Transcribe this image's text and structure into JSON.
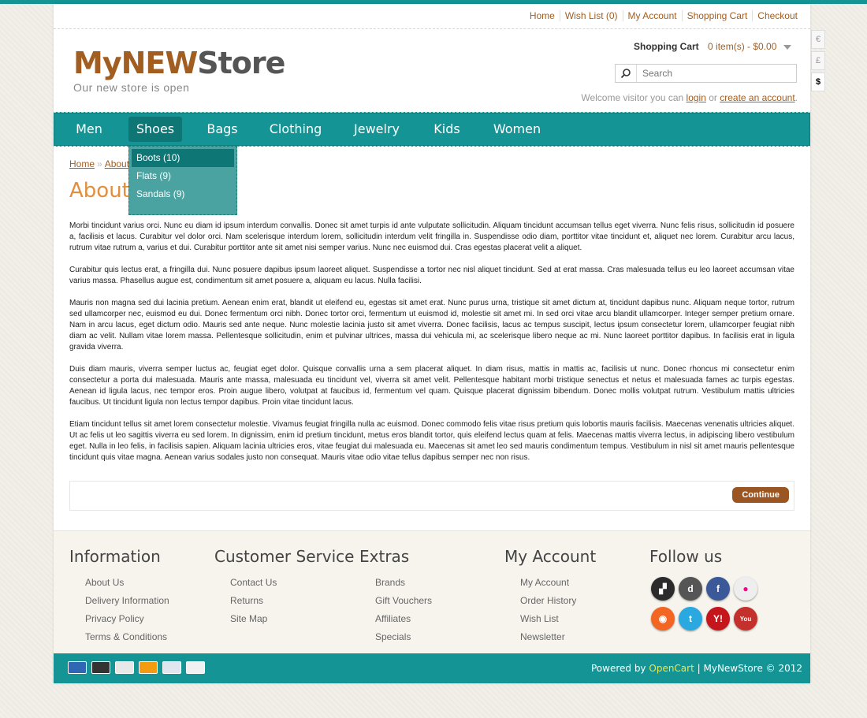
{
  "toplinks": [
    "Home",
    "Wish List (0)",
    "My Account",
    "Shopping Cart",
    "Checkout"
  ],
  "logo": {
    "part1": "MyNEW",
    "part2": "Store",
    "tagline": "Our new store is open"
  },
  "cart": {
    "label": "Shopping Cart",
    "value": "0 item(s) - $0.00"
  },
  "search": {
    "placeholder": "Search"
  },
  "welcome": {
    "text": "Welcome visitor you can",
    "login": "login",
    "or": "or",
    "create": "create an account",
    "end": "."
  },
  "currency": [
    "€",
    "£",
    "$"
  ],
  "nav": [
    "Men",
    "Shoes",
    "Bags",
    "Clothing",
    "Jewelry",
    "Kids",
    "Women"
  ],
  "dropdown": [
    "Boots (10)",
    "Flats (9)",
    "Sandals (9)"
  ],
  "breadcrumb": {
    "home": "Home",
    "sep": "»",
    "about": "About Us"
  },
  "page_title": "About Us",
  "paragraphs": [
    "Morbi tincidunt varius orci. Nunc eu diam id ipsum interdum convallis. Donec sit amet turpis id ante vulputate sollicitudin. Aliquam tincidunt accumsan tellus eget viverra. Nunc felis risus, sollicitudin id posuere a, facilisis et lacus. Curabitur vel dolor orci. Nam scelerisque interdum lorem, sollicitudin interdum velit fringilla in. Suspendisse odio diam, porttitor vitae tincidunt et, aliquet nec lorem. Curabitur arcu lacus, rutrum vitae rutrum a, varius et dui. Curabitur porttitor ante sit amet nisi semper varius. Nunc nec euismod dui. Cras egestas placerat velit a aliquet.",
    "Curabitur quis lectus erat, a fringilla dui. Nunc posuere dapibus ipsum laoreet aliquet. Suspendisse a tortor nec nisl aliquet tincidunt. Sed at erat massa. Cras malesuada tellus eu leo laoreet accumsan vitae varius massa. Phasellus augue est, condimentum sit amet posuere a, aliquam eu lacus. Nulla facilisi.",
    "Mauris non magna sed dui lacinia pretium. Aenean enim erat, blandit ut eleifend eu, egestas sit amet erat. Nunc purus urna, tristique sit amet dictum at, tincidunt dapibus nunc. Aliquam neque tortor, rutrum sed ullamcorper nec, euismod eu dui. Donec fermentum orci nibh. Donec tortor orci, fermentum ut euismod id, molestie sit amet mi. In sed orci vitae arcu blandit ullamcorper. Integer semper pretium ornare. Nam in arcu lacus, eget dictum odio. Mauris sed ante neque. Nunc molestie lacinia justo sit amet viverra. Donec facilisis, lacus ac tempus suscipit, lectus ipsum consectetur lorem, ullamcorper feugiat nibh diam ac velit. Nullam vitae lorem massa. Pellentesque sollicitudin, enim et pulvinar ultrices, massa dui vehicula mi, ac scelerisque libero neque ac mi. Nunc laoreet porttitor dapibus. In facilisis erat in ligula gravida viverra.",
    "Duis diam mauris, viverra semper luctus ac, feugiat eget dolor. Quisque convallis urna a sem placerat aliquet. In diam risus, mattis in mattis ac, facilisis ut nunc. Donec rhoncus mi consectetur enim consectetur a porta dui malesuada. Mauris ante massa, malesuada eu tincidunt vel, viverra sit amet velit. Pellentesque habitant morbi tristique senectus et netus et malesuada fames ac turpis egestas. Aenean id ligula lacus, nec tempor eros. Proin augue libero, volutpat at faucibus id, fermentum vel quam. Quisque placerat dignissim bibendum. Donec mollis volutpat rutrum. Vestibulum mattis ultricies faucibus. Ut tincidunt ligula non lectus tempor dapibus. Proin vitae tincidunt lacus.",
    "Etiam tincidunt tellus sit amet lorem consectetur molestie. Vivamus feugiat fringilla nulla ac euismod. Donec commodo felis vitae risus pretium quis lobortis mauris facilisis. Maecenas venenatis ultricies aliquet. Ut ac felis ut leo sagittis viverra eu sed lorem. In dignissim, enim id pretium tincidunt, metus eros blandit tortor, quis eleifend lectus quam at felis. Maecenas mattis viverra lectus, in adipiscing libero vestibulum eget. Nulla in leo felis, in facilisis sapien. Aliquam lacinia ultricies eros, vitae feugiat dui malesuada eu. Maecenas sit amet leo sed mauris condimentum tempus. Vestibulum in nisl sit amet mauris pellentesque tincidunt quis vitae magna. Aenean varius sodales justo non consequat. Mauris vitae odio vitae tellus dapibus semper nec non risus."
  ],
  "continue_label": "Continue",
  "footer": {
    "info": {
      "title": "Information",
      "links": [
        "About Us",
        "Delivery Information",
        "Privacy Policy",
        "Terms & Conditions"
      ]
    },
    "service": {
      "title": "Customer Service",
      "links": [
        "Contact Us",
        "Returns",
        "Site Map"
      ]
    },
    "extras": {
      "title": "Extras",
      "links": [
        "Brands",
        "Gift Vouchers",
        "Affiliates",
        "Specials"
      ]
    },
    "account": {
      "title": "My Account",
      "links": [
        "My Account",
        "Order History",
        "Wish List",
        "Newsletter"
      ]
    },
    "follow": {
      "title": "Follow us"
    }
  },
  "social_icons": [
    "delicious-icon",
    "digg-icon",
    "facebook-icon",
    "flickr-icon",
    "rss-icon",
    "twitter-icon",
    "yahoo-icon",
    "youtube-icon"
  ],
  "powered": {
    "prefix": "Powered by",
    "brand": "OpenCart",
    "suffix": "| MyNewStore © 2012"
  },
  "colors": {
    "teal": "#149494",
    "brown": "#a25e21",
    "orange": "#e28e3d"
  }
}
